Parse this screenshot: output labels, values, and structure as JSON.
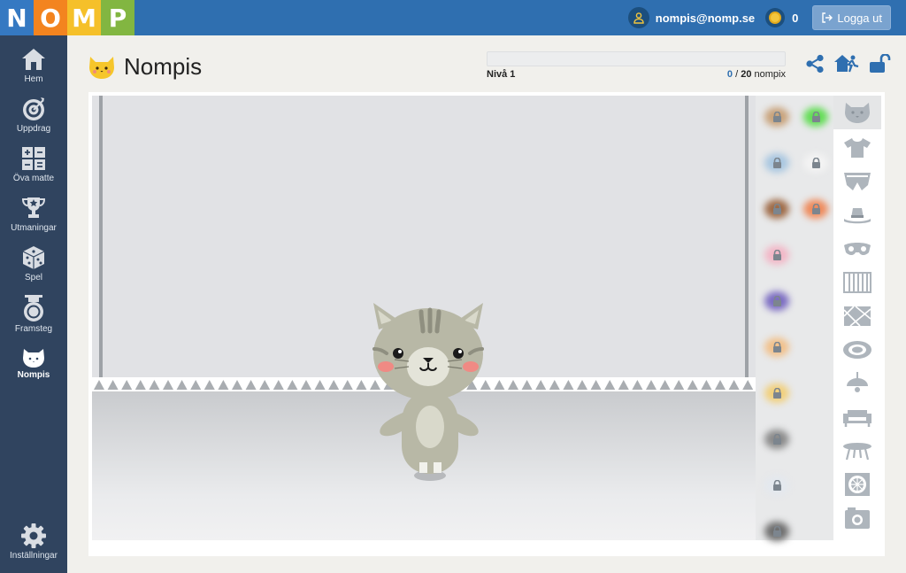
{
  "logo": {
    "letters": [
      "N",
      "O",
      "M",
      "P"
    ],
    "colors": [
      "#3579c2",
      "#f3841f",
      "#f5c02a",
      "#82b641"
    ]
  },
  "header": {
    "user_email": "nompis@nomp.se",
    "coins": "0",
    "logout_label": "Logga ut",
    "user_icon": "user-icon",
    "logout_icon": "sign-out-icon"
  },
  "sidebar": {
    "items": [
      {
        "label": "Hem",
        "icon": "home-icon"
      },
      {
        "label": "Uppdrag",
        "icon": "target-icon"
      },
      {
        "label": "Öva matte",
        "icon": "calculator-icon"
      },
      {
        "label": "Utmaningar",
        "icon": "trophy-icon"
      },
      {
        "label": "Spel",
        "icon": "dice-icon"
      },
      {
        "label": "Framsteg",
        "icon": "medal-icon"
      },
      {
        "label": "Nompis",
        "icon": "cat-icon"
      }
    ],
    "settings_label": "Inställningar",
    "active": "Nompis"
  },
  "page": {
    "title": "Nompis",
    "level_label": "Nivå 1",
    "nompix_current": "0",
    "nompix_separator": " / ",
    "nompix_total": "20",
    "nompix_unit": " nompix",
    "progress": 0
  },
  "top_icons": [
    "share-icon",
    "house-runner-icon",
    "unlock-icon"
  ],
  "categories": [
    "cat-face-icon",
    "shirt-icon",
    "pants-icon",
    "hat-icon",
    "glasses-icon",
    "wallpaper-icon",
    "floor-tiles-icon",
    "rug-icon",
    "lamp-icon",
    "sofa-icon",
    "table-icon",
    "window-icon",
    "camera-icon"
  ],
  "item_colors": {
    "left": [
      "#c8a27a",
      "#a8c6e0",
      "#9e6a46",
      "#f2b6c6",
      "#7b6cc2",
      "#f1c08a",
      "#f1cf7a",
      "#8a8a8a",
      "#e3e8ee",
      "#6e6e6e"
    ],
    "right": [
      "#62dc55",
      "#f3f3f3",
      "#ee8a5b"
    ]
  },
  "theme": {
    "accent": "#2f6fb0",
    "sidebar": "#30445f"
  }
}
